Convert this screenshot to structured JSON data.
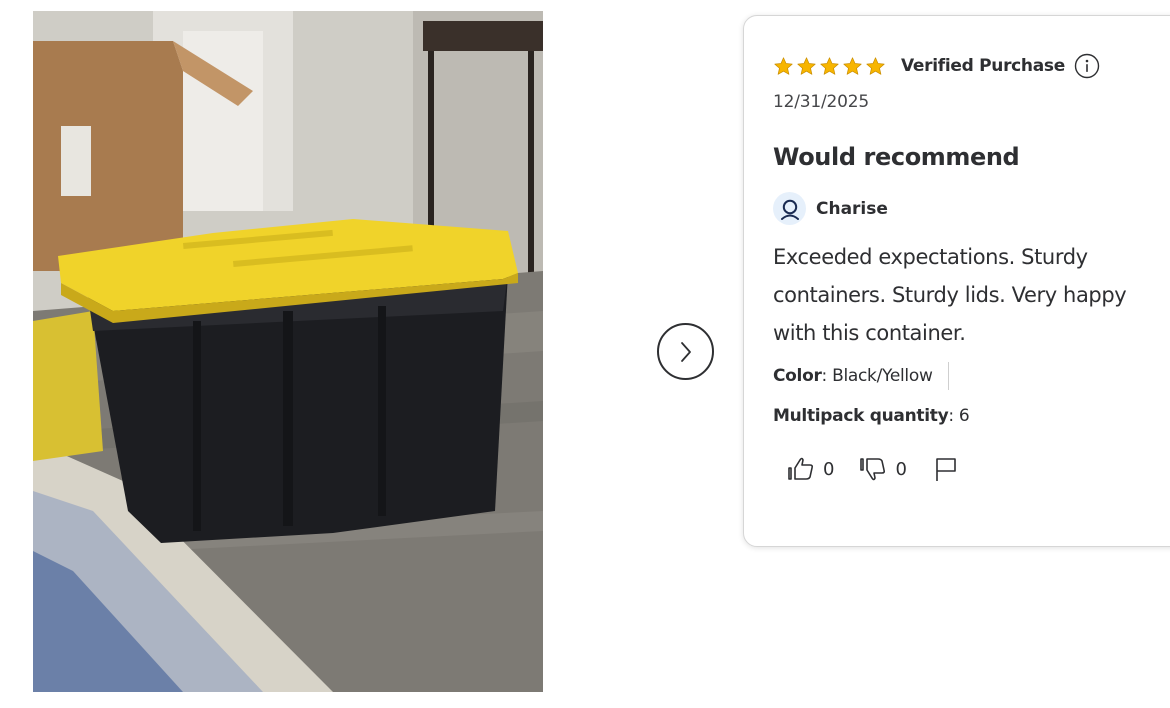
{
  "photo": {
    "icon": "review-photo"
  },
  "carousel": {
    "next_icon": "chevron-right-icon"
  },
  "review": {
    "rating": 5,
    "rating_max": 5,
    "star_color": "#f7b500",
    "verified_label": "Verified Purchase",
    "date": "12/31/2025",
    "title": "Would recommend",
    "author": "Charise",
    "body": "Exceeded expectations. Sturdy containers. Sturdy lids. Very happy with this container.",
    "attributes": [
      {
        "name": "Color",
        "value": "Black/Yellow"
      },
      {
        "name": "Multipack quantity",
        "value": "6"
      }
    ],
    "helpful_count": "0",
    "unhelpful_count": "0",
    "colors": {
      "text": "#2e2f32",
      "avatar_bg": "#e6f0fb",
      "avatar_icon": "#1a2b52"
    }
  }
}
